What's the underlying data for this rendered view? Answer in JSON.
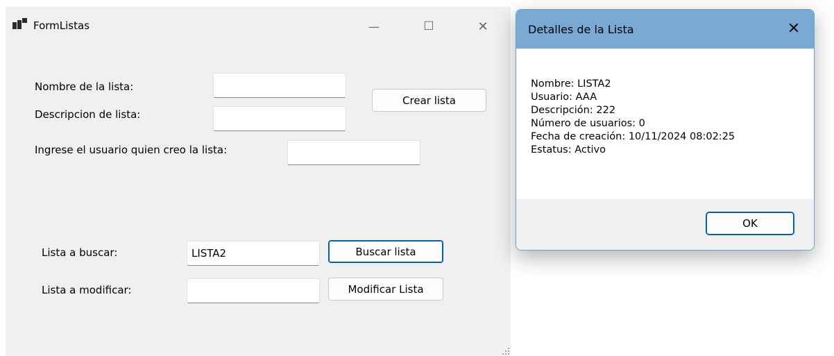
{
  "form": {
    "title": "FormListas",
    "controls": {
      "minimize": "—",
      "maximize": "☐",
      "close": "✕"
    },
    "labels": {
      "nombre": "Nombre de la lista:",
      "descripcion": "Descripcion de lista:",
      "usuario": "Ingrese el usuario quien creo la lista:",
      "buscar": "Lista a buscar:",
      "modificar": "Lista a modificar:"
    },
    "inputs": {
      "nombre": "",
      "descripcion": "",
      "usuario": "",
      "buscar": "LISTA2",
      "modificar": ""
    },
    "buttons": {
      "crear": "Crear lista",
      "buscar": "Buscar lista",
      "modificar": "Modificar Lista"
    }
  },
  "dialog": {
    "title": "Detalles de la Lista",
    "close": "✕",
    "lines": [
      "Nombre: LISTA2",
      "Usuario: AAA",
      "Descripción: 222",
      "Número de usuarios: 0",
      "Fecha de creación: 10/11/2024 08:02:25",
      "Estatus: Activo"
    ],
    "ok": "OK"
  }
}
